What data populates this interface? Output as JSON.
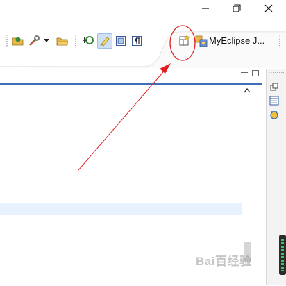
{
  "window": {
    "minimize_icon": "minimize-icon",
    "restore_icon": "restore-icon",
    "close_icon": "close-icon"
  },
  "toolbar": {
    "perspective_label": "MyEclipse J...",
    "buttons": [
      "open-folder-icon",
      "wrench-icon",
      "dropdown-arrow-icon",
      "open-file-icon",
      "refresh-search-icon",
      "highlighter-icon",
      "block-selection-icon",
      "pilcrow-icon",
      "open-perspective-icon",
      "perspective-icon"
    ]
  },
  "editor": {
    "highlighted_line": true
  },
  "right_trim": {
    "buttons": [
      "restore-view-icon",
      "outline-view-icon",
      "project-view-icon"
    ]
  },
  "annotation": {
    "color": "#e02020"
  },
  "watermark": {
    "text": "Bai百经验"
  },
  "colors": {
    "accent": "#3d6fb6",
    "highlight": "#e8f2fe",
    "annotation": "#e02020"
  }
}
